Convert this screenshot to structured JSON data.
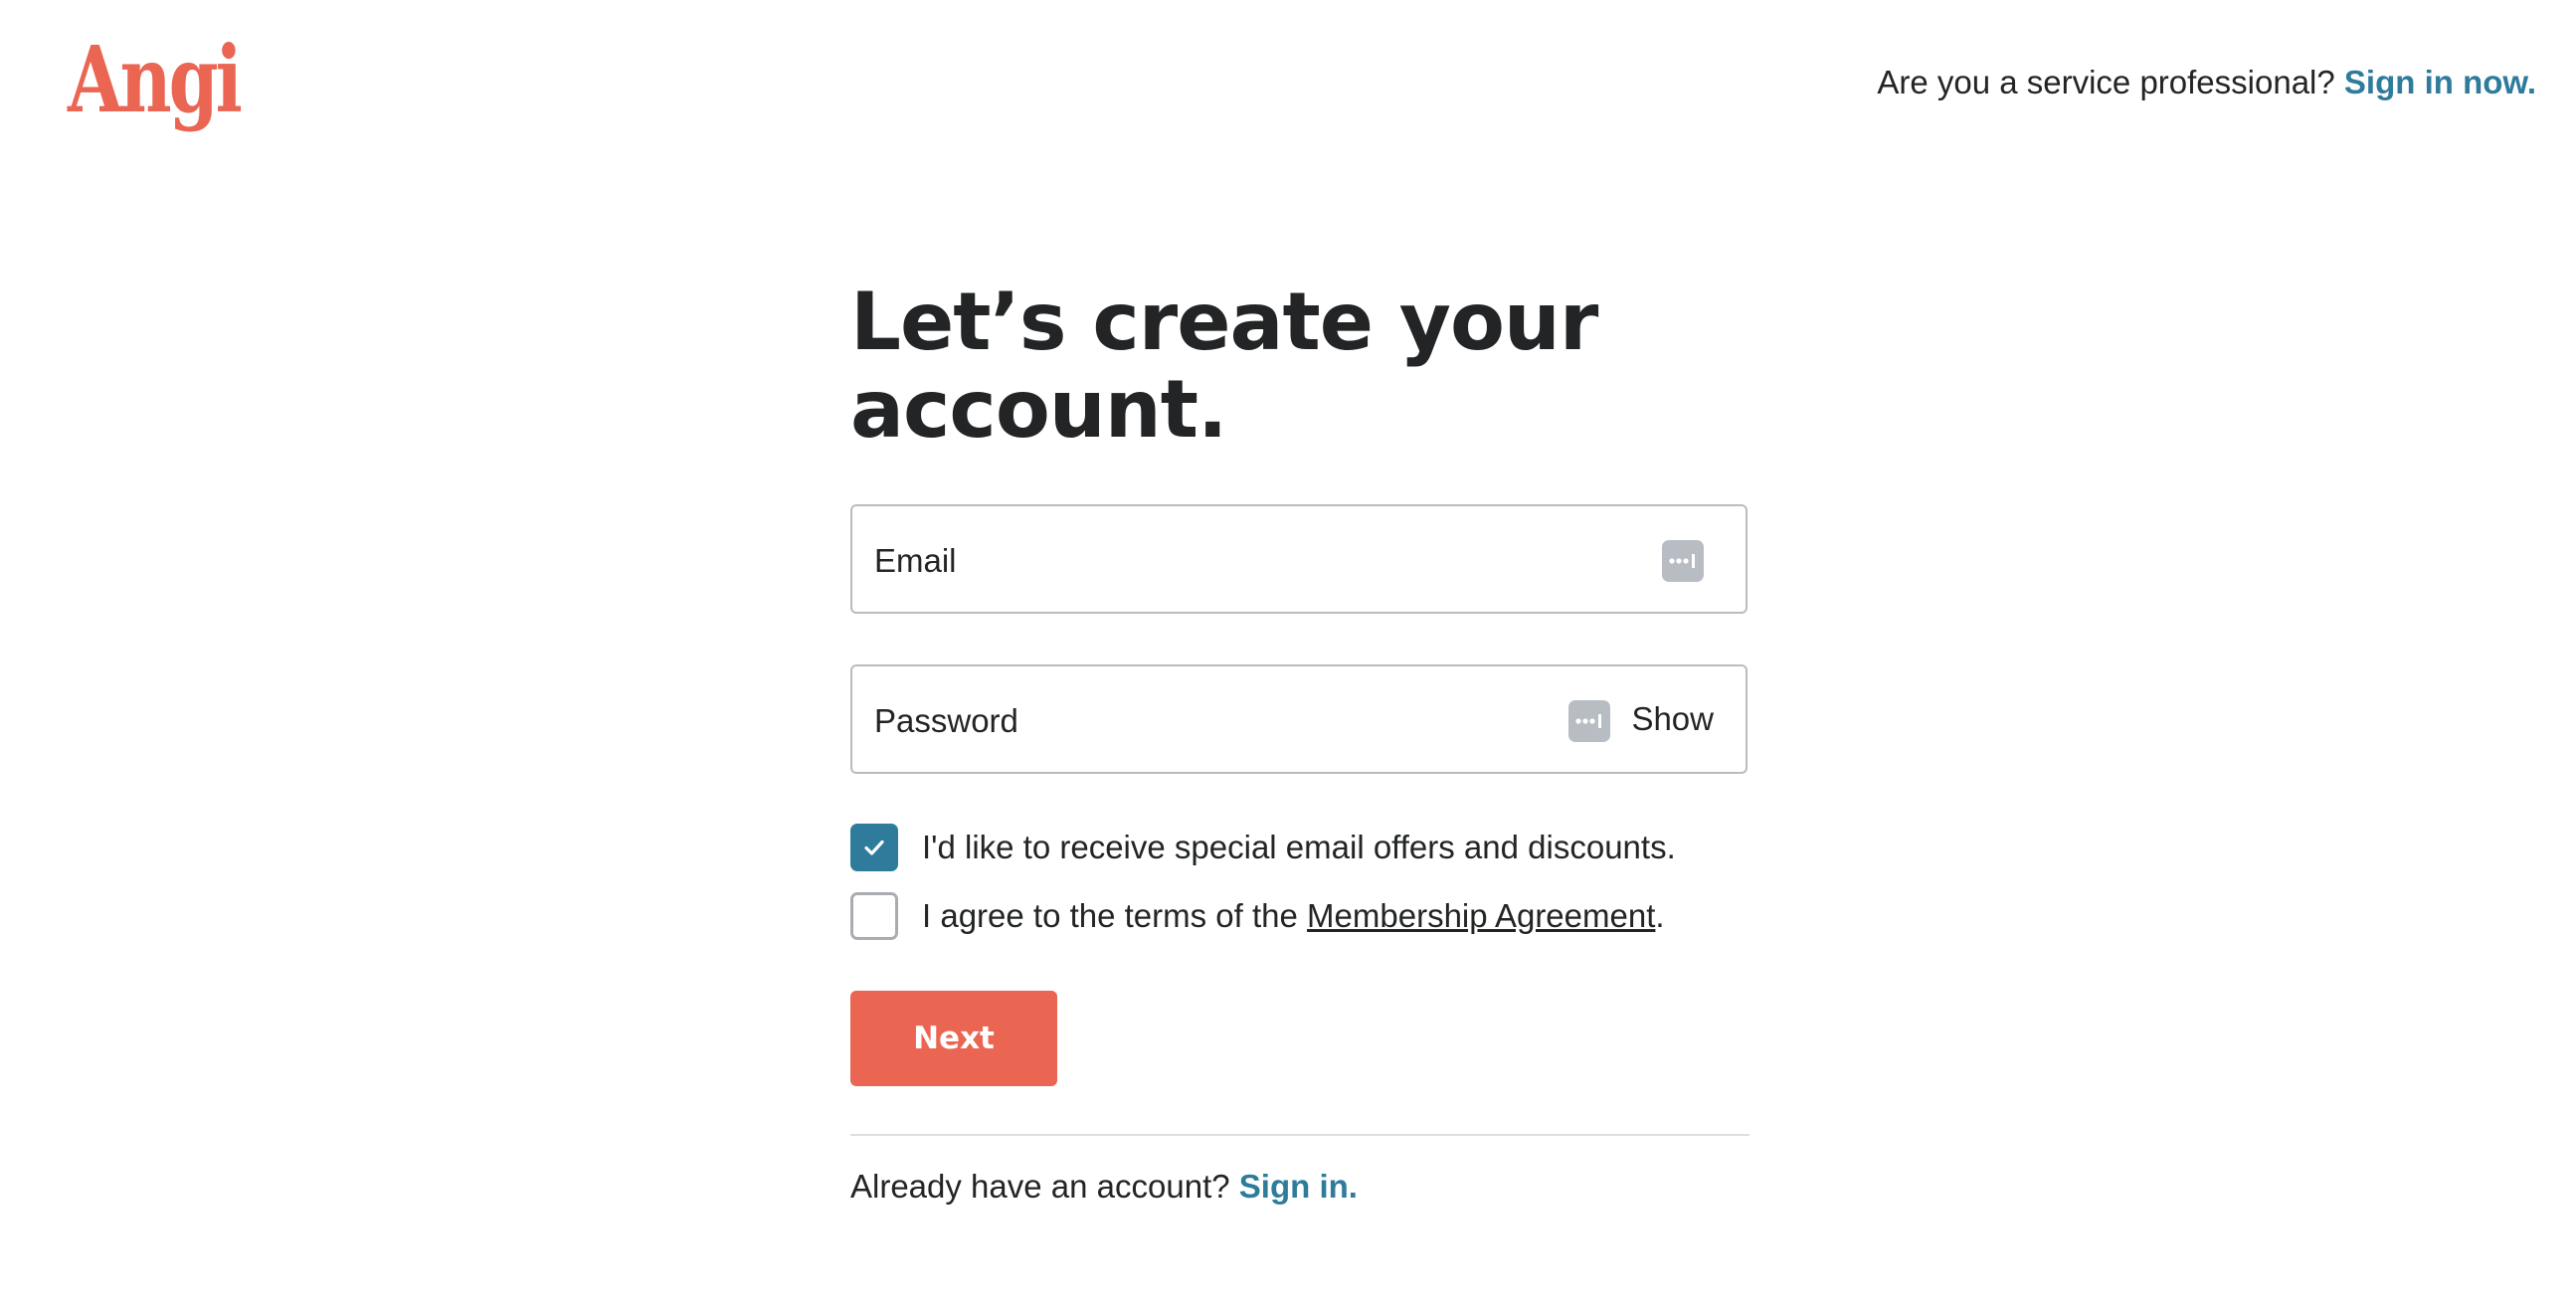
{
  "brand": {
    "logo_text": "Angi",
    "accent_color": "#ea6552",
    "link_color": "#2e7b9c"
  },
  "header": {
    "pro_prompt": "Are you a service professional?",
    "pro_link": "Sign in now."
  },
  "form": {
    "title": "Let’s create your account.",
    "email": {
      "placeholder": "Email",
      "value": "",
      "autofill_icon": "password-manager-icon"
    },
    "password": {
      "placeholder": "Password",
      "value": "",
      "autofill_icon": "password-manager-icon",
      "show_label": "Show"
    },
    "offers_checkbox": {
      "label": "I'd like to receive special email offers and discounts.",
      "checked": true,
      "icon": "checkmark-icon"
    },
    "terms_checkbox": {
      "label_prefix": "I agree to the terms of the ",
      "link_text": "Membership Agreement",
      "label_suffix": ".",
      "checked": false
    },
    "next_label": "Next"
  },
  "footer": {
    "prompt": "Already have an account?",
    "link": "Sign in."
  }
}
